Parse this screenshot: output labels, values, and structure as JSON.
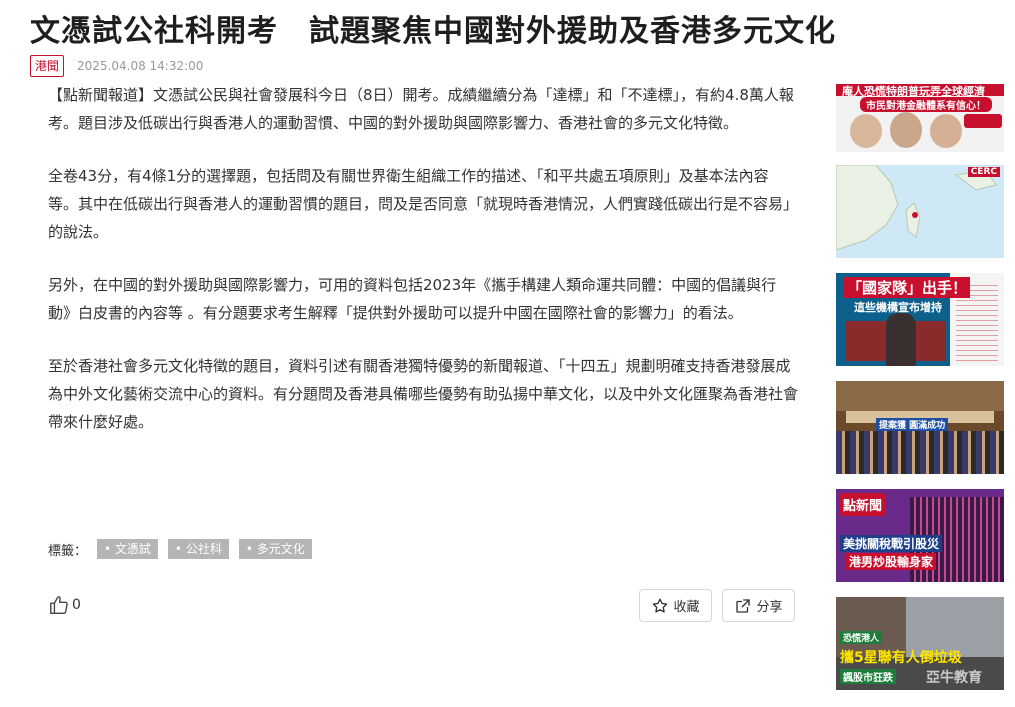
{
  "article": {
    "title": "文憑試公社科開考　試題聚焦中國對外援助及香港多元文化",
    "source_tag": "港聞",
    "datetime": "2025.04.08 14:32:00",
    "paragraphs": [
      "【點新聞報道】文憑試公民與社會發展科今日（8日）開考。成績繼續分為「達標」和「不達標」，有約4.8萬人報考。題目涉及低碳出行與香港人的運動習慣、中國的對外援助與國際影響力、香港社會的多元文化特徵。",
      "全卷43分，有4條1分的選擇題，包括問及有關世界衛生組織工作的描述、「和平共處五項原則」及基本法內容等。其中在低碳出行與香港人的運動習慣的題目，問及是否同意「就現時香港情況，人們實踐低碳出行是不容易」的說法。",
      "另外，在中國的對外援助與國際影響力，可用的資料包括2023年《攜手構建人類命運共同體：中國的倡議與行動》白皮書的內容等 。有分題要求考生解釋「提供對外援助可以提升中國在國際社會的影響力」的看法。",
      "至於香港社會多元文化特徵的題目，資料引述有關香港獨特優勢的新聞報道、「十四五」規劃明確支持香港發展成為中外文化藝術交流中心的資料。有分題問及香港具備哪些優勢有助弘揚中華文化，以及中外文化匯聚為香港社會帶來什麼好處。"
    ],
    "tags_label": "標籤：",
    "tags": [
      "• 文憑試",
      "• 公社科",
      "• 多元文化"
    ],
    "like_count": "0",
    "favorite_label": "收藏",
    "share_label": "分享"
  },
  "sidebar": {
    "items": [
      {
        "caption_top": "庵人恐慌特朗普玩弄全球經濟",
        "caption_mid": "市民對港金融體系有信心！"
      },
      {
        "caption_top": "CERC"
      },
      {
        "caption_top": "「國家隊」出手！",
        "caption_mid": "這些機構宣布增持"
      },
      {
        "caption_top": "提案獲 圓滿成功"
      },
      {
        "caption_top": "點新聞",
        "caption_mid": "美挑關稅戰引股災",
        "caption_bottom": "港男炒股輸身家"
      },
      {
        "caption_top": "恐慌港人",
        "caption_mid": "攜5星聯有人倒垃圾",
        "caption_bottom": "諷股市狂跌",
        "watermark": "亞牛教育"
      }
    ]
  },
  "colors": {
    "accent": "#c8102e",
    "tag_chip": "#b5b5b5",
    "text": "#333333"
  }
}
